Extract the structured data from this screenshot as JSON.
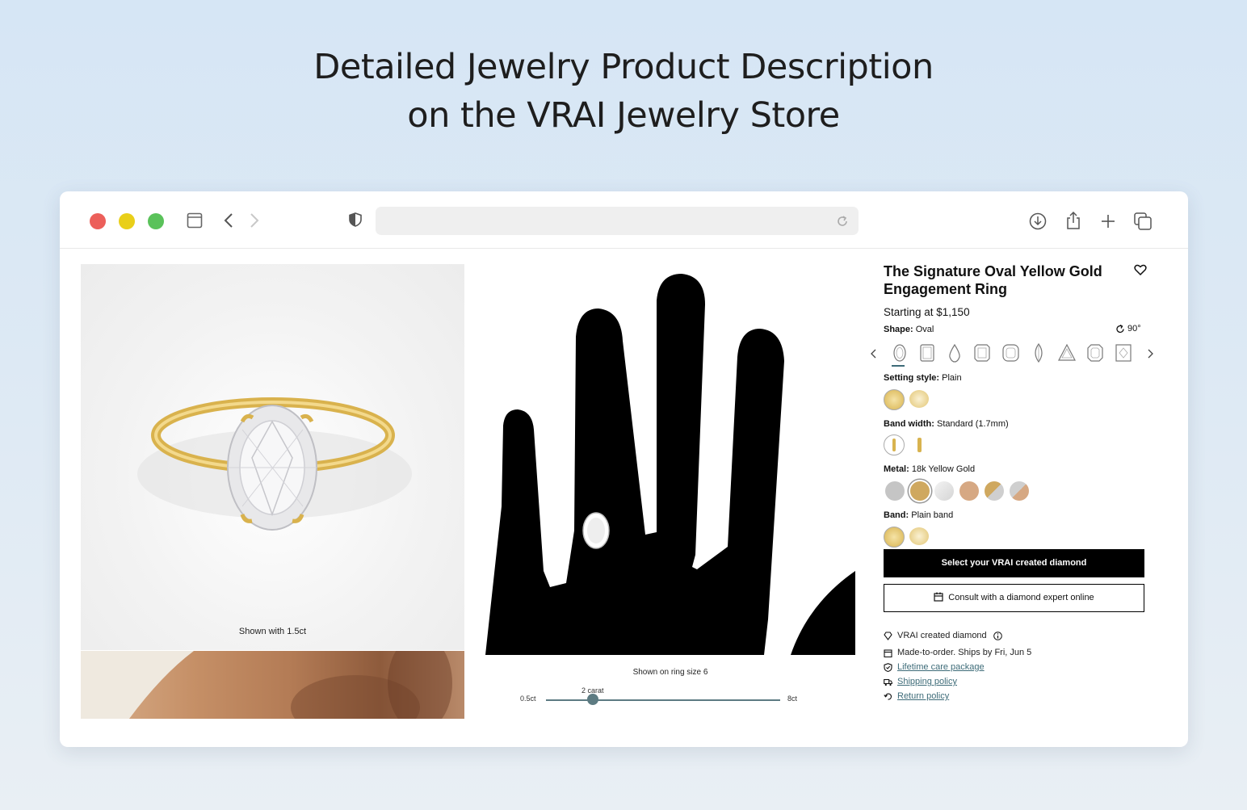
{
  "headline": {
    "line1": "Detailed Jewelry Product Description",
    "line2": "on the VRAI Jewelry Store"
  },
  "browser": {
    "traffic_lights": [
      "#ec5f5a",
      "#e9cf19",
      "#5ac25a"
    ],
    "url": ""
  },
  "gallery": {
    "caption": "Shown with 1.5ct"
  },
  "hand_view": {
    "caption": "Shown on ring size 6",
    "slider": {
      "min_label": "0.5ct",
      "max_label": "8ct",
      "value_label": "2 carat",
      "value": 2,
      "min": 0.5,
      "max": 8
    }
  },
  "product": {
    "title": "The Signature Oval Yellow Gold Engagement Ring",
    "price": "Starting at $1,150",
    "shape_label": "Shape:",
    "shape_value": "Oval",
    "rotate_label": "90°",
    "shapes": [
      "oval",
      "emerald",
      "pear",
      "radiant",
      "cushion",
      "marquise",
      "trillion",
      "asscher",
      "princess"
    ],
    "setting_label": "Setting style:",
    "setting_value": "Plain",
    "bandwidth_label": "Band width:",
    "bandwidth_value": "Standard (1.7mm)",
    "metal_label": "Metal:",
    "metal_value": "18k Yellow Gold",
    "metals": [
      "#c5c5c5",
      "#cfa85f",
      "#e4e4e4",
      "#d6a883",
      "split-gold-silver",
      "split-rose-silver"
    ],
    "band_label": "Band:",
    "band_value": "Plain band",
    "primary_button": "Select your VRAI created diamond",
    "secondary_button": "Consult with a diamond expert online",
    "info": [
      {
        "icon": "diamond-icon",
        "text": "VRAI created diamond",
        "link": false
      },
      {
        "icon": "calendar-icon",
        "text": "Made-to-order. Ships by Fri, Jun 5",
        "link": false
      },
      {
        "icon": "shield-icon",
        "text": "Lifetime care package",
        "link": true
      },
      {
        "icon": "truck-icon",
        "text": "Shipping policy",
        "link": true
      },
      {
        "icon": "return-icon",
        "text": "Return policy",
        "link": true
      }
    ]
  }
}
